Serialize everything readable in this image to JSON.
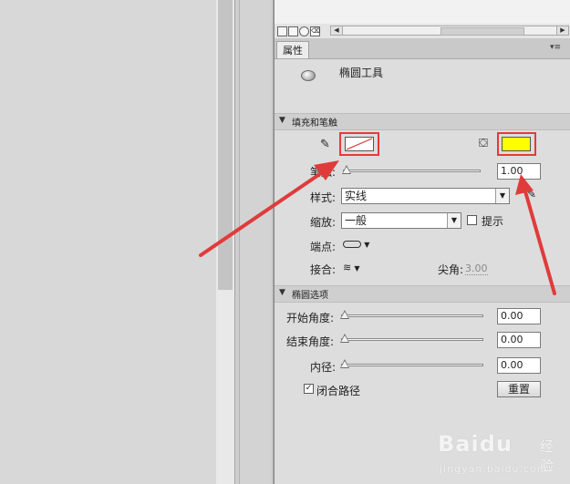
{
  "panel": {
    "tab_label": "属性",
    "tool_name": "椭圆工具",
    "menu_glyph": "▾≡"
  },
  "fill_stroke": {
    "section_title": "填充和笔触",
    "stroke_color": "none",
    "fill_color": "#ffff00",
    "thickness_label": "笔触:",
    "thickness_value": "1.00",
    "style_label": "样式:",
    "style_value": "实线",
    "scale_label": "缩放:",
    "scale_value": "一般",
    "hint_label": "提示",
    "hint_checked": false,
    "cap_label": "端点:",
    "join_label": "接合:",
    "miter_label": "尖角:",
    "miter_value": "3.00"
  },
  "ellipse_options": {
    "section_title": "椭圆选项",
    "start_angle_label": "开始角度:",
    "start_angle_value": "0.00",
    "end_angle_label": "结束角度:",
    "end_angle_value": "0.00",
    "inner_radius_label": "内径:",
    "inner_radius_value": "0.00",
    "close_path_label": "闭合路径",
    "close_path_checked": true,
    "reset_label": "重置"
  },
  "watermark": {
    "brand": "Baidu",
    "tail": "经验",
    "url": "jingyan.baidu.com"
  },
  "colors": {
    "highlight_red": "#e63a3a",
    "fill_yellow": "#ffff00",
    "arrow_red": "#e03b3b"
  }
}
